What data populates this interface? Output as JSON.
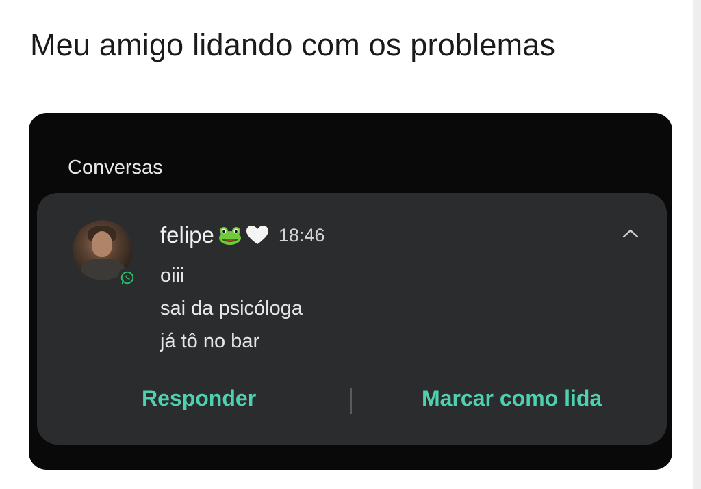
{
  "caption": "Meu amigo lidando com os problemas",
  "notification": {
    "section_label": "Conversas",
    "sender": "felipe",
    "emoji_icons": [
      "frog-emoji",
      "white-heart-emoji"
    ],
    "time": "18:46",
    "app_icon": "whatsapp-icon",
    "messages": [
      "oiii",
      "sai da psicóloga",
      "já tô no bar"
    ],
    "actions": {
      "reply": "Responder",
      "mark_read": "Marcar como lida"
    },
    "accent_color": "#4fd1b0"
  }
}
